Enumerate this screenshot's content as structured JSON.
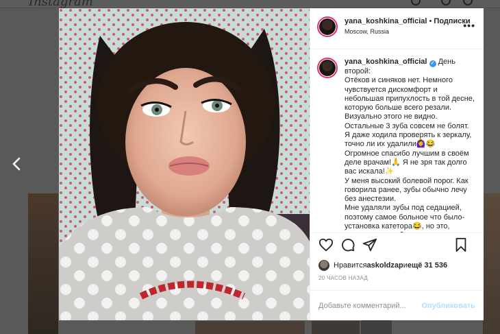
{
  "background": {
    "logo": "Instagram"
  },
  "post": {
    "header": {
      "username": "yana_koshkina_official",
      "separator": " • ",
      "follow_label": "Подписки",
      "location": "Moscow, Russia",
      "more_icon": "ellipsis-icon"
    },
    "caption": {
      "username": "yana_koshkina_official",
      "verified_icon": "verified-badge-icon",
      "paragraphs": [
        "День второй:\nОтёков и синяков нет. Немного чувствуется дискомфорт и небольшая припухлость в той десне, которую больше всего резали. Визуально этого не видно. Остальные 3 зуба совсем не болят. Я даже ходила проверять к зеркалу, точно ли их удалили🙆‍♀️😂",
        "Огромное спасибо лучшим в своём деле врачам!🙏 Я не зря так долго вас искала!✨",
        "У меня высокий болевой порог. Как говорила ранее, зубы обычно лечу без анестезии.",
        "Мне удаляли зубы под седацией, поэтому самое больное что было- установка катетора😂, но это, разумеется, не больно"
      ]
    },
    "actions": {
      "like_icon": "heart-icon",
      "comment_icon": "comment-icon",
      "share_icon": "share-icon",
      "save_icon": "bookmark-icon"
    },
    "likes": {
      "prefix": "Нравится ",
      "liker": "askoldzap",
      "middle": " и ",
      "count_text": "ещё 31 536"
    },
    "timestamp": "20 ЧАСОВ НАЗАД",
    "comment_box": {
      "placeholder": "Добавьте комментарий...",
      "post_label": "Опубликовать"
    }
  },
  "navigation": {
    "prev_icon": "chevron-left-icon"
  },
  "colors": {
    "accent": "#3897f0",
    "post_button_disabled": "#b2dffc",
    "avatar_ring": "#e1306c"
  }
}
